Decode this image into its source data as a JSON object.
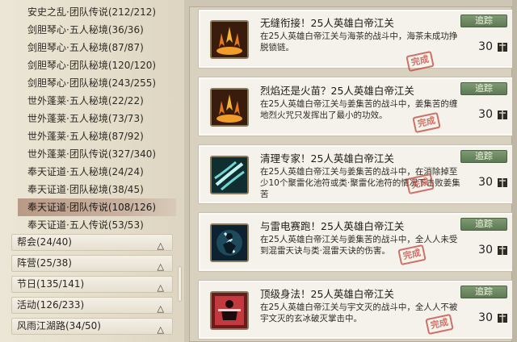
{
  "achievement_list": [
    {
      "label": "安史之乱·团队传说(212/212)"
    },
    {
      "label": "剑胆琴心·五人秘境(36/36)"
    },
    {
      "label": "剑胆琴心·五人秘境(87/87)"
    },
    {
      "label": "剑胆琴心·团队秘境(120/120)"
    },
    {
      "label": "剑胆琴心·团队秘境(243/255)"
    },
    {
      "label": "世外蓬莱·五人秘境(22/22)"
    },
    {
      "label": "世外蓬莱·五人秘境(73/73)"
    },
    {
      "label": "世外蓬莱·五人秘境(87/92)"
    },
    {
      "label": "世外蓬莱·团队传说(327/340)"
    },
    {
      "label": "奉天证道·五人秘境(24/24)"
    },
    {
      "label": "奉天证道·团队秘境(38/45)"
    },
    {
      "label": "奉天证道·团队传说(108/126)"
    },
    {
      "label": "奉天证道·五人传说(53/53)"
    }
  ],
  "categories": [
    {
      "label": "帮会(24/40)"
    },
    {
      "label": "阵营(25/38)"
    },
    {
      "label": "节日(135/141)"
    },
    {
      "label": "活动(126/233)"
    },
    {
      "label": "风雨江湖路(34/50)"
    }
  ],
  "cards": [
    {
      "title": "无缝衔接！25人英雄白帝江关",
      "desc": "在25人英雄白帝江关与海茶的战斗中，海茶未成功挣脱锁链。",
      "track_label": "追踪",
      "points": "30",
      "icon": "flame-icon",
      "stamp": "完成"
    },
    {
      "title": "烈焰还是火苗？25人英雄白帝江关",
      "desc": "在25人英雄白帝江关与姜集苦的战斗中，姜集苦的缠地烈火咒只发挥出了最小的功效。",
      "track_label": "追踪",
      "points": "30",
      "icon": "flame-icon",
      "stamp": "完成"
    },
    {
      "title": "清理专家！25人英雄白帝江关",
      "desc": "在25人英雄白帝江关与姜集苦的战斗中，在消除掉至少10个聚雷化池符或类·聚雷化池符的情况下击败姜集苦",
      "track_label": "追踪",
      "points": "30",
      "icon": "wind-slash-icon",
      "stamp": "完成"
    },
    {
      "title": "与雷电赛跑！25人英雄白帝江关",
      "desc": "在25人英雄白帝江关与姜集苦的战斗中，全人人未受到混雷天诀与类·混雷天诀的伤害。",
      "track_label": "追踪",
      "points": "30",
      "icon": "lightning-figure-icon",
      "stamp": "完成"
    },
    {
      "title": "顶级身法！25人英雄白帝江关",
      "desc": "在25人英雄白帝江关与宇文灭的战斗中，全人人不被宇文灭的玄冰破灭掌击中。",
      "track_label": "追踪",
      "points": "30",
      "icon": "warrior-icon",
      "stamp": "完成"
    }
  ],
  "colors": {
    "selected_row": "#b89a86",
    "track_button": "#6b8661",
    "stamp": "#c0473b"
  }
}
